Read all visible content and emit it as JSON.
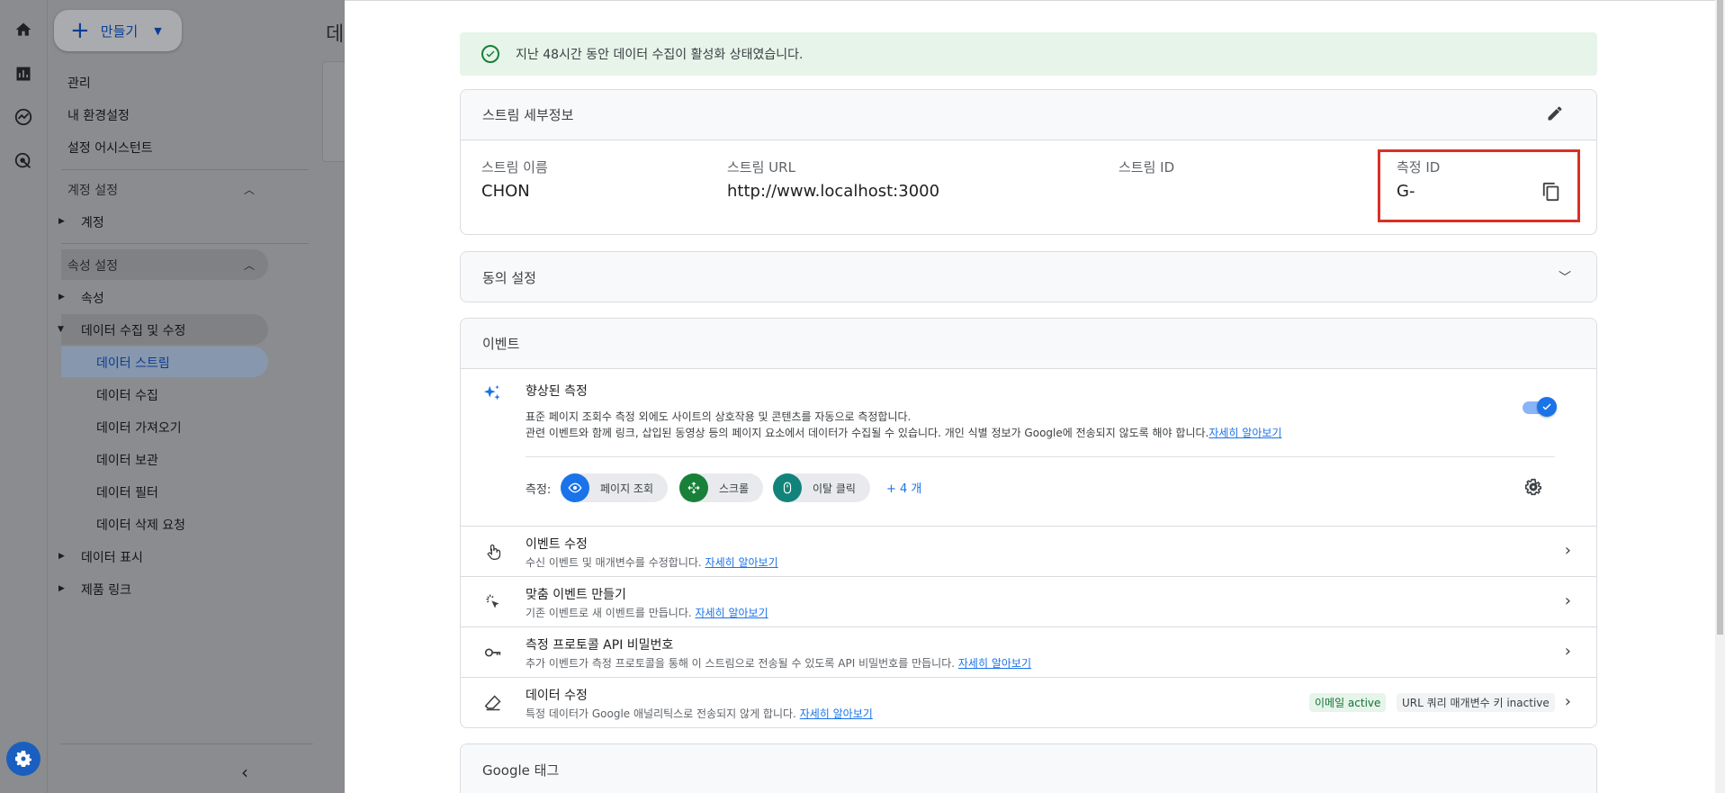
{
  "nav": {
    "create_label": "만들기",
    "top_items": [
      "관리",
      "내 환경설정",
      "설정 어시스턴트"
    ],
    "account_section": "계정 설정",
    "account_items": [
      "계정"
    ],
    "property_section": "속성 설정",
    "property_items": [
      "속성",
      "데이터 수집 및 수정"
    ],
    "data_items": [
      "데이터 스트림",
      "데이터 수집",
      "데이터 가져오기",
      "데이터 보관",
      "데이터 필터",
      "데이터 삭제 요청"
    ],
    "bottom_items": [
      "데이터 표시",
      "제품 링크"
    ]
  },
  "background": {
    "title_fragment": "데"
  },
  "banner": {
    "text": "지난 48시간 동안 데이터 수집이 활성화 상태였습니다."
  },
  "stream_details": {
    "title": "스트림 세부정보",
    "name_label": "스트림 이름",
    "name_value": "CHON",
    "url_label": "스트림 URL",
    "url_value": "http://www.localhost:3000",
    "id_label": "스트림 ID",
    "id_value": "",
    "measurement_label": "측정 ID",
    "measurement_value": "G-"
  },
  "consent": {
    "title": "동의 설정"
  },
  "events": {
    "title": "이벤트",
    "enhanced": {
      "title": "향상된 측정",
      "desc1": "표준 페이지 조회수 측정 외에도 사이트의 상호작용 및 콘텐츠를 자동으로 측정합니다.",
      "desc2": "관련 이벤트와 함께 링크, 삽입된 동영상 등의 페이지 요소에서 데이터가 수집될 수 있습니다. 개인 식별 정보가 Google에 전송되지 않도록 해야 합니다.",
      "learn_more": "자세히 알아보기",
      "measure_label": "측정:",
      "chips": [
        "페이지 조회",
        "스크롤",
        "이탈 클릭"
      ],
      "more": "+ 4 개",
      "toggle_on": true
    },
    "rows": [
      {
        "title": "이벤트 수정",
        "desc": "수신 이벤트 및 매개변수를 수정합니다.",
        "link": "자세히 알아보기"
      },
      {
        "title": "맞춤 이벤트 만들기",
        "desc": "기존 이벤트로 새 이벤트를 만듭니다.",
        "link": "자세히 알아보기"
      },
      {
        "title": "측정 프로토콜 API 비밀번호",
        "desc": "추가 이벤트가 측정 프로토콜을 통해 이 스트림으로 전송될 수 있도록 API 비밀번호를 만듭니다.",
        "link": "자세히 알아보기"
      },
      {
        "title": "데이터 수정",
        "desc": "특정 데이터가 Google 애널리틱스로 전송되지 않게 합니다.",
        "link": "자세히 알아보기",
        "tag_active": "이메일 active",
        "tag_inactive": "URL 쿼리 매개변수 키 inactive"
      }
    ]
  },
  "google_tag": {
    "title": "Google 태그"
  },
  "colors": {
    "accent": "#1a73e8",
    "success": "#188038",
    "highlight": "#d93025"
  }
}
